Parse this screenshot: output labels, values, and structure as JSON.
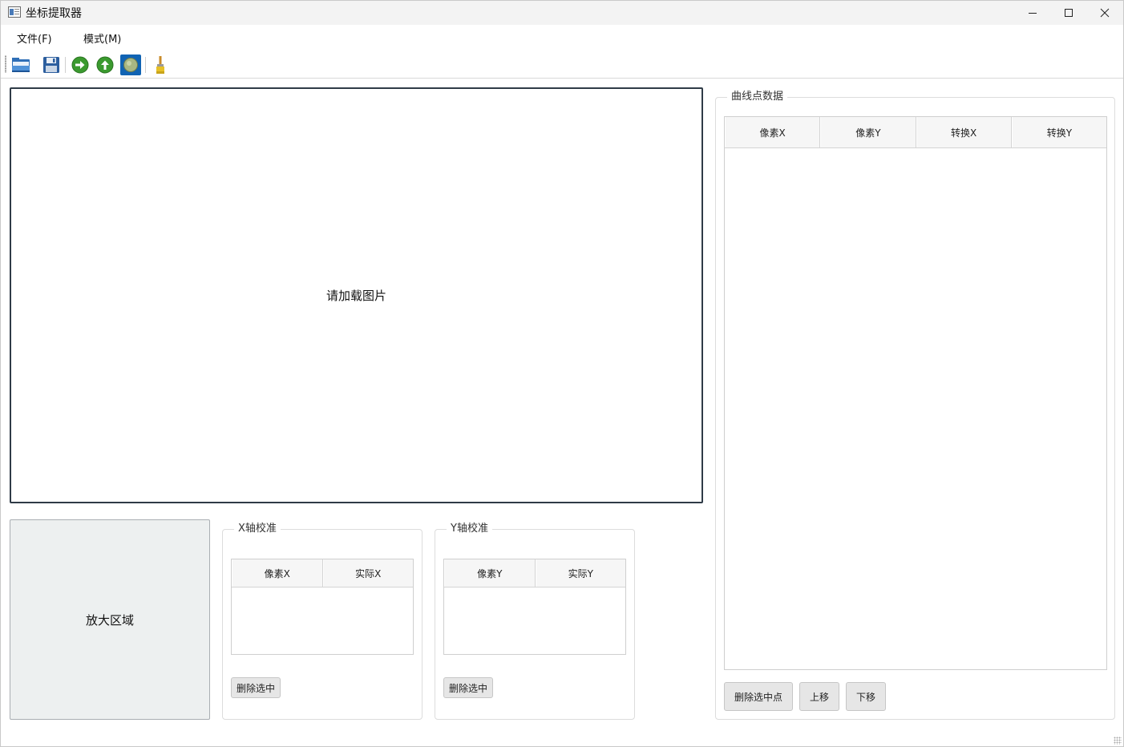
{
  "window": {
    "title": "坐标提取器"
  },
  "menu": {
    "file": "文件(F)",
    "mode": "模式(M)"
  },
  "toolbar": {
    "buttons": [
      {
        "icon": "open-folder-icon"
      },
      {
        "icon": "save-icon"
      },
      {
        "icon": "arrow-right-icon"
      },
      {
        "icon": "arrow-up-icon"
      },
      {
        "icon": "point-mode-icon",
        "active": true
      },
      {
        "icon": "brush-icon"
      }
    ]
  },
  "main": {
    "image_placeholder": "请加载图片",
    "zoom_label": "放大区域"
  },
  "x_calibration": {
    "title": "X轴校准",
    "columns": [
      "像素X",
      "实际X"
    ],
    "rows": [],
    "delete_button": "删除选中"
  },
  "y_calibration": {
    "title": "Y轴校准",
    "columns": [
      "像素Y",
      "实际Y"
    ],
    "rows": [],
    "delete_button": "删除选中"
  },
  "curve_points": {
    "title": "曲线点数据",
    "columns": [
      "像素X",
      "像素Y",
      "转换X",
      "转换Y"
    ],
    "rows": [],
    "delete_button": "删除选中点",
    "up_button": "上移",
    "down_button": "下移"
  },
  "colors": {
    "accent": "#1063b3",
    "image_border": "#2f3b47",
    "zoom_bg": "#edf0f0"
  }
}
